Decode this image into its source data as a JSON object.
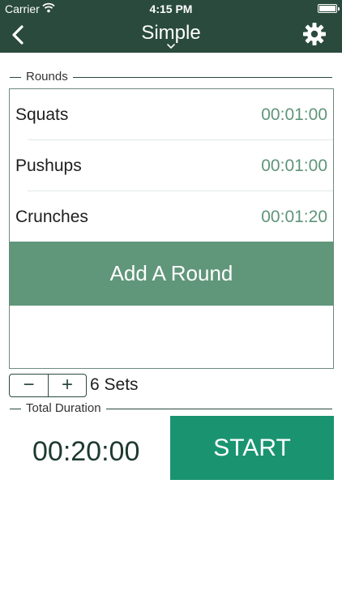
{
  "status_bar": {
    "carrier": "Carrier",
    "time": "4:15 PM"
  },
  "nav": {
    "title": "Simple"
  },
  "rounds_section": {
    "label": "Rounds"
  },
  "rounds": [
    {
      "name": "Squats",
      "duration": "00:01:00"
    },
    {
      "name": "Pushups",
      "duration": "00:01:00"
    },
    {
      "name": "Crunches",
      "duration": "00:01:20"
    }
  ],
  "add_round_label": "Add A Round",
  "stepper": {
    "minus": "−",
    "plus": "+"
  },
  "sets_label": "6 Sets",
  "total_section": {
    "label": "Total Duration"
  },
  "total_duration": "00:20:00",
  "start_label": "START",
  "colors": {
    "header_bg": "#2a4a3e",
    "accent_green": "#60967a",
    "start_green": "#1a9470",
    "duration_text": "#5e9579"
  },
  "icons": [
    "wifi-icon",
    "battery-icon",
    "back-chevron-icon",
    "dropdown-chevron-icon",
    "gear-icon"
  ]
}
